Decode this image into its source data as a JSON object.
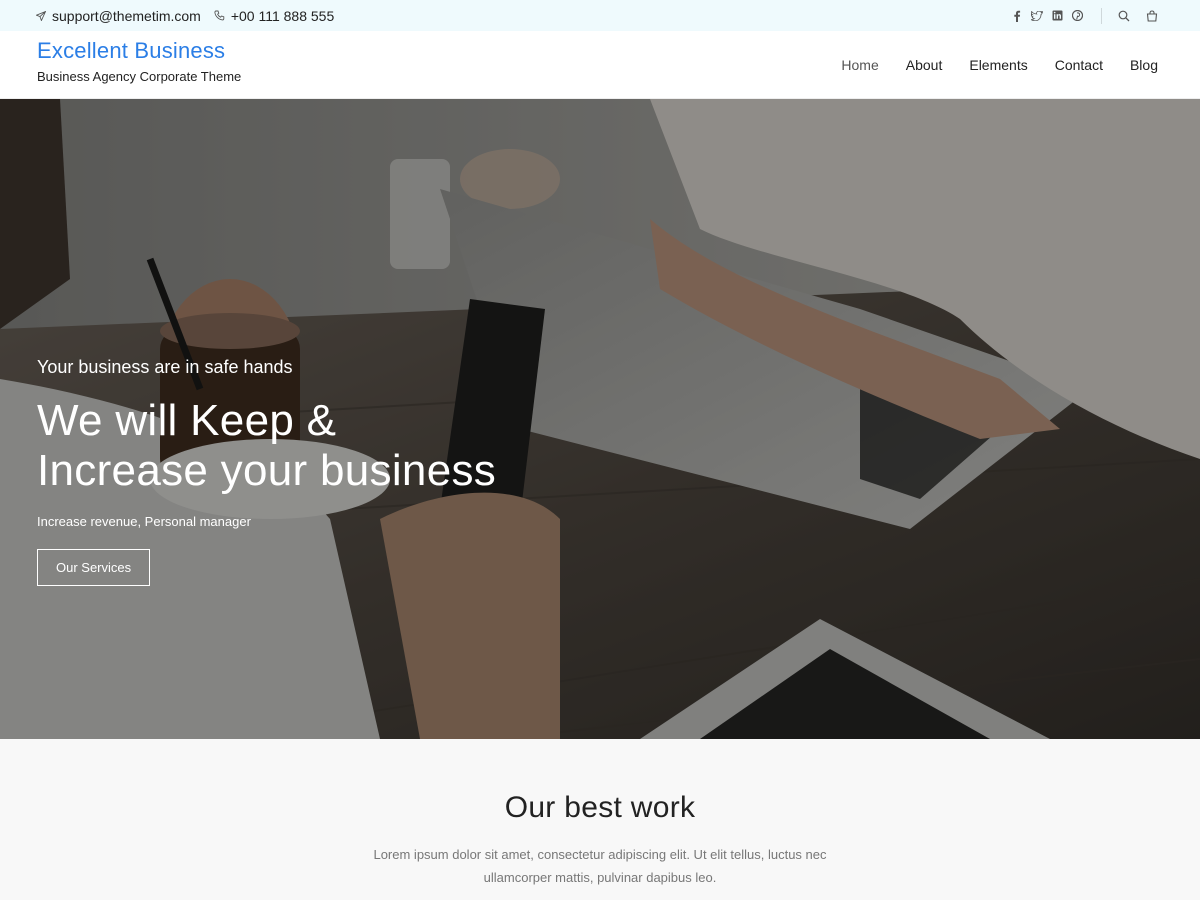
{
  "topbar": {
    "email": "support@themetim.com",
    "phone": "+00 111 888 555",
    "social": [
      "facebook-icon",
      "twitter-icon",
      "linkedin-icon",
      "pinterest-icon"
    ],
    "tools": [
      "search-icon",
      "cart-icon"
    ]
  },
  "brand": {
    "title": "Excellent Business",
    "tagline": "Business Agency Corporate Theme",
    "color": "#2b7ee6"
  },
  "nav": {
    "items": [
      {
        "label": "Home",
        "active": true
      },
      {
        "label": "About"
      },
      {
        "label": "Elements"
      },
      {
        "label": "Contact"
      },
      {
        "label": "Blog"
      }
    ]
  },
  "hero": {
    "kicker": "Your business are in safe hands",
    "headline_line1": "We will Keep &",
    "headline_line2": "Increase your business",
    "subtext": "Increase revenue, Personal manager",
    "button_label": "Our Services"
  },
  "section": {
    "title": "Our best work",
    "description": "Lorem ipsum dolor sit amet, consectetur adipiscing elit. Ut elit tellus, luctus nec ullamcorper mattis, pulvinar dapibus leo."
  }
}
